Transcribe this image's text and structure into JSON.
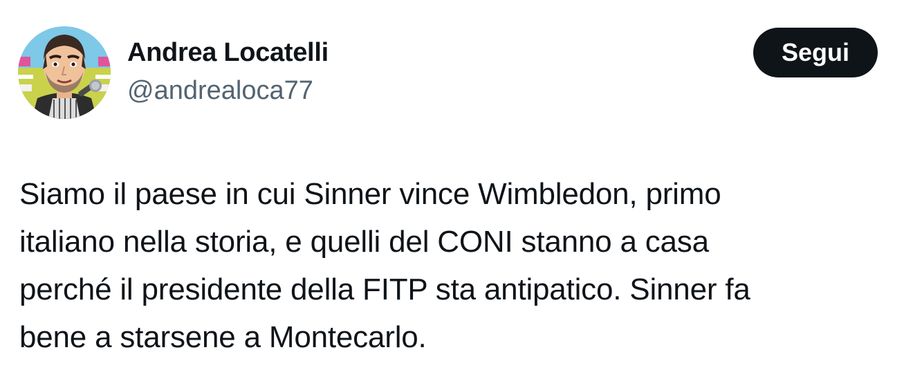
{
  "author": {
    "display_name": "Andrea Locatelli",
    "handle": "@andrealoca77",
    "avatar_icon": "cartoon-avatar-with-microphone"
  },
  "actions": {
    "follow_label": "Segui"
  },
  "tweet": {
    "lines": [
      "Siamo il paese in cui Sinner vince Wimbledon, primo",
      "italiano nella storia, e quelli del CONI stanno a casa",
      "perché il presidente della FITP sta antipatico. Sinner fa",
      "bene a starsene a Montecarlo."
    ]
  },
  "colors": {
    "text": "#0f1419",
    "secondary_text": "#536471",
    "button_bg": "#0f1419",
    "button_text": "#ffffff"
  }
}
